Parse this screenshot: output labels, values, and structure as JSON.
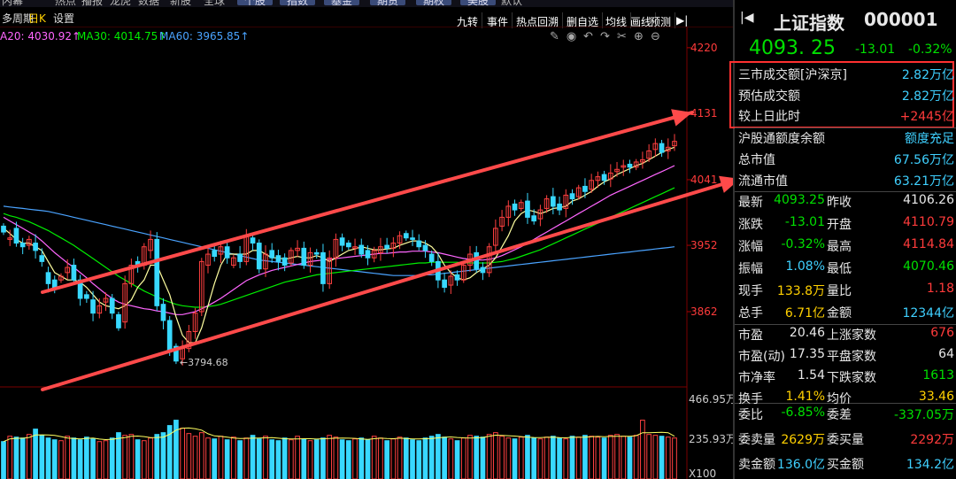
{
  "top_bar": {
    "items": [
      "内幕",
      "热点",
      "播报",
      "龙虎",
      "数据",
      "新股",
      "全球",
      "个股",
      "指数",
      "基金",
      "期货",
      "期权",
      "美股",
      "默认"
    ]
  },
  "sub_bar": {
    "left": [
      "多周期",
      "日K",
      "设置"
    ],
    "right": [
      "九转",
      "事件",
      "热点回溯",
      "删自选",
      "均线",
      "画线",
      "预测"
    ]
  },
  "ma_legend": {
    "ma20": "A20: 4030.92↑",
    "ma30": "MA30: 4014.75↑",
    "ma60": "MA60: 3965.85↑"
  },
  "colors": {
    "ma20": "#ff66ff",
    "ma30": "#00ee00",
    "ma60": "#4aa3ff",
    "up": "#ff4040",
    "down": "#38d8ff",
    "channel": "#ff4a4a",
    "highlight_box": "#ff3030"
  },
  "chart_data": {
    "type": "candlestick",
    "y_ticks": [
      "4220",
      "4131",
      "4041",
      "3952",
      "3862"
    ],
    "low_label": "3794.68",
    "volume_ticks": [
      "466.95万",
      "235.93万",
      "X100"
    ],
    "close": [
      3970,
      3962,
      3955,
      3950,
      3960,
      3945,
      3930,
      3900,
      3895,
      3910,
      3922,
      3905,
      3880,
      3880,
      3860,
      3870,
      3880,
      3860,
      3840,
      3900,
      3925,
      3925,
      3950,
      3960,
      3870,
      3850,
      3810,
      3795,
      3812,
      3835,
      3860,
      3930,
      3940,
      3937,
      3950,
      3935,
      3935,
      3930,
      3965,
      3955,
      3920,
      3940,
      3935,
      3930,
      3925,
      3945,
      3948,
      3925,
      3942,
      3940,
      3900,
      3935,
      3960,
      3952,
      3950,
      3950,
      3940,
      3935,
      3945,
      3950,
      3948,
      3955,
      3965,
      3962,
      3960,
      3950,
      3945,
      3930,
      3905,
      3895,
      3910,
      3905,
      3925,
      3940,
      3920,
      3915,
      3950,
      3975,
      3990,
      4005,
      4000,
      4010,
      3990,
      3985,
      4000,
      4015,
      4005,
      4000,
      4020,
      4015,
      4030,
      4025,
      4040,
      4045,
      4040,
      4050,
      4055,
      4060,
      4058,
      4065,
      4068,
      4080,
      4090,
      4078,
      4085,
      4093
    ],
    "open": [
      3978,
      3960,
      3975,
      3955,
      3952,
      3955,
      3938,
      3915,
      3905,
      3905,
      3915,
      3925,
      3905,
      3885,
      3878,
      3860,
      3875,
      3880,
      3858,
      3848,
      3900,
      3930,
      3925,
      3945,
      3960,
      3872,
      3850,
      3815,
      3798,
      3812,
      3835,
      3862,
      3925,
      3945,
      3940,
      3950,
      3925,
      3940,
      3930,
      3962,
      3955,
      3920,
      3945,
      3938,
      3935,
      3928,
      3945,
      3948,
      3925,
      3942,
      3942,
      3900,
      3935,
      3962,
      3955,
      3948,
      3952,
      3945,
      3935,
      3942,
      3952,
      3948,
      3955,
      3968,
      3962,
      3958,
      3952,
      3940,
      3930,
      3905,
      3898,
      3912,
      3905,
      3925,
      3942,
      3922,
      3915,
      3952,
      3978,
      3990,
      4008,
      4002,
      4012,
      3992,
      3988,
      4002,
      4018,
      4008,
      4002,
      4022,
      4018,
      4032,
      4028,
      4040,
      4048,
      4042,
      4052,
      4058,
      4062,
      4058,
      4065,
      4070,
      4082,
      4090,
      4080,
      4087
    ],
    "ma5": [
      3975,
      3968,
      3960,
      3955,
      3955,
      3950,
      3945,
      3930,
      3915,
      3910,
      3905,
      3905,
      3902,
      3895,
      3885,
      3875,
      3870,
      3868,
      3866,
      3870,
      3878,
      3895,
      3905,
      3925,
      3925,
      3905,
      3885,
      3855,
      3830,
      3820,
      3820,
      3840,
      3870,
      3900,
      3925,
      3940,
      3940,
      3940,
      3940,
      3945,
      3945,
      3940,
      3935,
      3935,
      3933,
      3935,
      3937,
      3935,
      3935,
      3938,
      3935,
      3930,
      3935,
      3940,
      3945,
      3947,
      3950,
      3948,
      3946,
      3946,
      3947,
      3948,
      3952,
      3955,
      3958,
      3958,
      3955,
      3950,
      3940,
      3925,
      3915,
      3908,
      3905,
      3908,
      3915,
      3920,
      3925,
      3935,
      3950,
      3965,
      3985,
      3995,
      4000,
      3998,
      3995,
      3998,
      4002,
      4003,
      4005,
      4012,
      4015,
      4020,
      4025,
      4032,
      4038,
      4042,
      4048,
      4052,
      4056,
      4060,
      4063,
      4068,
      4073,
      4078,
      4082,
      4085
    ],
    "ma20": [
      3990,
      3985,
      3980,
      3975,
      3970,
      3965,
      3958,
      3950,
      3942,
      3935,
      3928,
      3922,
      3915,
      3908,
      3900,
      3893,
      3886,
      3880,
      3875,
      3872,
      3870,
      3868,
      3866,
      3865,
      3863,
      3862,
      3860,
      3858,
      3858,
      3860,
      3862,
      3866,
      3870,
      3875,
      3880,
      3886,
      3892,
      3898,
      3904,
      3908,
      3912,
      3915,
      3918,
      3920,
      3922,
      3924,
      3926,
      3928,
      3930,
      3931,
      3932,
      3933,
      3934,
      3935,
      3936,
      3937,
      3938,
      3939,
      3940,
      3941,
      3941,
      3942,
      3943,
      3943,
      3944,
      3944,
      3944,
      3943,
      3942,
      3940,
      3938,
      3936,
      3934,
      3933,
      3932,
      3932,
      3933,
      3935,
      3938,
      3942,
      3946,
      3950,
      3955,
      3960,
      3965,
      3970,
      3975,
      3980,
      3985,
      3990,
      3995,
      4000,
      4005,
      4010,
      4015,
      4020,
      4024,
      4028,
      4032,
      4036,
      4040,
      4044,
      4048,
      4052,
      4056,
      4060
    ],
    "ma30": [
      3995,
      3992,
      3990,
      3987,
      3984,
      3980,
      3976,
      3972,
      3967,
      3962,
      3957,
      3952,
      3946,
      3940,
      3934,
      3928,
      3922,
      3916,
      3910,
      3905,
      3900,
      3895,
      3890,
      3886,
      3882,
      3878,
      3875,
      3872,
      3870,
      3869,
      3868,
      3868,
      3869,
      3870,
      3872,
      3875,
      3878,
      3881,
      3884,
      3887,
      3890,
      3893,
      3896,
      3899,
      3902,
      3904,
      3906,
      3908,
      3910,
      3912,
      3913,
      3914,
      3915,
      3916,
      3917,
      3918,
      3919,
      3920,
      3921,
      3922,
      3923,
      3924,
      3925,
      3926,
      3927,
      3928,
      3928,
      3929,
      3929,
      3929,
      3929,
      3929,
      3928,
      3928,
      3928,
      3928,
      3928,
      3929,
      3930,
      3932,
      3934,
      3937,
      3940,
      3943,
      3946,
      3950,
      3954,
      3958,
      3962,
      3966,
      3970,
      3974,
      3978,
      3982,
      3986,
      3990,
      3994,
      3998,
      4002,
      4006,
      4010,
      4014,
      4018,
      4022,
      4026,
      4030
    ],
    "ma60": [
      4005,
      4004,
      4003,
      4002,
      4001,
      4000,
      3999,
      3998,
      3996,
      3994,
      3992,
      3990,
      3988,
      3986,
      3984,
      3982,
      3980,
      3978,
      3976,
      3974,
      3972,
      3970,
      3968,
      3966,
      3964,
      3962,
      3960,
      3958,
      3956,
      3954,
      3952,
      3950,
      3948,
      3946,
      3944,
      3942,
      3940,
      3938,
      3936,
      3934,
      3932,
      3931,
      3930,
      3929,
      3928,
      3927,
      3926,
      3925,
      3924,
      3923,
      3922,
      3921,
      3920,
      3919,
      3918,
      3917,
      3916,
      3915,
      3914,
      3913,
      3912,
      3911,
      3911,
      3911,
      3911,
      3911,
      3912,
      3912,
      3913,
      3914,
      3915,
      3916,
      3917,
      3918,
      3919,
      3920,
      3921,
      3922,
      3923,
      3924,
      3925,
      3926,
      3927,
      3928,
      3929,
      3930,
      3931,
      3932,
      3933,
      3934,
      3935,
      3936,
      3937,
      3938,
      3939,
      3940,
      3941,
      3942,
      3943,
      3944,
      3945,
      3946,
      3947,
      3948,
      3949,
      3950
    ],
    "volume": [
      210,
      240,
      235,
      230,
      250,
      280,
      245,
      230,
      220,
      215,
      240,
      230,
      220,
      235,
      225,
      210,
      215,
      230,
      260,
      245,
      250,
      220,
      215,
      230,
      250,
      260,
      300,
      330,
      285,
      255,
      240,
      260,
      230,
      225,
      240,
      220,
      235,
      215,
      230,
      245,
      225,
      240,
      220,
      215,
      230,
      220,
      240,
      225,
      215,
      220,
      230,
      245,
      235,
      220,
      215,
      225,
      230,
      220,
      240,
      230,
      215,
      225,
      235,
      230,
      220,
      215,
      230,
      240,
      250,
      235,
      225,
      215,
      230,
      245,
      240,
      235,
      250,
      260,
      240,
      230,
      225,
      235,
      245,
      230,
      225,
      235,
      240,
      230,
      225,
      240,
      235,
      245,
      240,
      235,
      230,
      245,
      250,
      240,
      235,
      245,
      330,
      250,
      245,
      240,
      235,
      230
    ]
  },
  "right_panel": {
    "title": "上证指数",
    "code": "000001",
    "price": "4093. 25",
    "change": "-13.01",
    "change_pct": "-0.32%",
    "highlight": [
      {
        "label": "三市成交额[沪深京]",
        "value": "2.82万亿"
      },
      {
        "label": "预估成交额",
        "value": "2.82万亿"
      },
      {
        "label": "较上日此时",
        "value": "+2445亿"
      }
    ],
    "info": [
      {
        "label": "沪股通额度余额",
        "value": "额度充足"
      },
      {
        "label": "总市值",
        "value": "67.56万亿"
      },
      {
        "label": "流通市值",
        "value": "63.21万亿"
      }
    ],
    "quote_rows": [
      {
        "l1": "最新",
        "v1": "4093.25",
        "l2": "昨收",
        "v2": "4106.26",
        "c1": "green",
        "c2": "white"
      },
      {
        "l1": "涨跌",
        "v1": "-13.01",
        "l2": "开盘",
        "v2": "4110.79",
        "c1": "green",
        "c2": "red"
      },
      {
        "l1": "涨幅",
        "v1": "-0.32%",
        "l2": "最高",
        "v2": "4114.84",
        "c1": "green",
        "c2": "red"
      },
      {
        "l1": "振幅",
        "v1": "1.08%",
        "l2": "最低",
        "v2": "4070.46",
        "c1": "cyan",
        "c2": "green"
      },
      {
        "l1": "现手",
        "v1": "133.8万",
        "l2": "量比",
        "v2": "1.18",
        "c1": "yel",
        "c2": "red"
      },
      {
        "l1": "总手",
        "v1": "6.71亿",
        "l2": "金额",
        "v2": "12344亿",
        "c1": "yel",
        "c2": "cyan"
      }
    ],
    "stat_rows": [
      {
        "l1": "市盈",
        "v1": "20.46",
        "l2": "上涨家数",
        "v2": "676",
        "c1": "white",
        "c2": "red"
      },
      {
        "l1": "市盈(动)",
        "v1": "17.35",
        "l2": "平盘家数",
        "v2": "64",
        "c1": "white",
        "c2": "white"
      },
      {
        "l1": "市净率",
        "v1": "1.54",
        "l2": "下跌家数",
        "v2": "1613",
        "c1": "white",
        "c2": "green"
      },
      {
        "l1": "换手",
        "v1": "1.41%",
        "l2": "均价",
        "v2": "33.46",
        "c1": "yel",
        "c2": "yel"
      }
    ],
    "order_rows": [
      {
        "l1": "委比",
        "v1": "-6.85%",
        "l2": "委差",
        "v2": "-337.05万",
        "c1": "green",
        "c2": "green"
      },
      {
        "l1": "委卖量",
        "v1": "2629万",
        "l2": "委买量",
        "v2": "2292万",
        "c1": "yel",
        "c2": "red"
      },
      {
        "l1": "卖金额",
        "v1": "136.0亿",
        "l2": "买金额",
        "v2": "134.2亿",
        "c1": "cyan",
        "c2": "cyan"
      }
    ]
  }
}
